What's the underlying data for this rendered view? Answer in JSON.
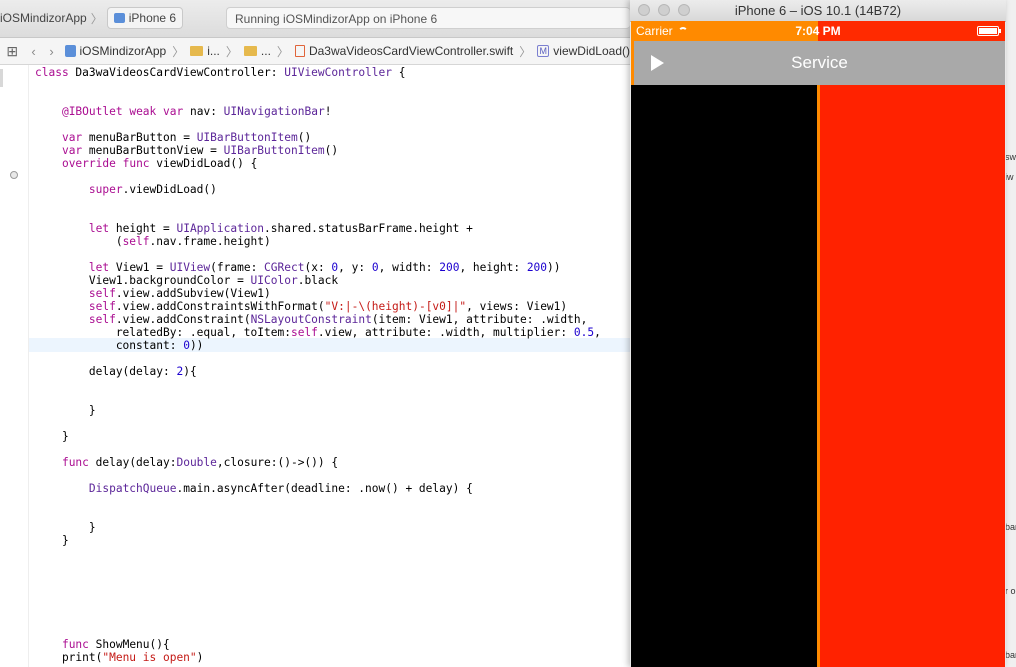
{
  "toolbar": {
    "scheme_name": "iOSMindizorApp",
    "device_name": "iPhone 6",
    "activity_status": "Running iOSMindizorApp on iPhone 6"
  },
  "jumpbar": {
    "crumbs": [
      "iOSMindizorApp",
      "i...",
      "...",
      "Da3waVideosCardViewController.swift",
      "viewDidLoad()"
    ]
  },
  "code": {
    "lines": [
      {
        "text": "class Da3waVideosCardViewController: UIViewController {"
      },
      {
        "text": "    @IBOutlet weak var nav: UINavigationBar!"
      },
      {
        "text": "    var menuBarButton = UIBarButtonItem()"
      },
      {
        "text": "    var menuBarButtonView = UIBarButtonItem()"
      },
      {
        "text": "    override func viewDidLoad() {"
      },
      {
        "text": "        super.viewDidLoad()"
      },
      {
        "text": "        let height = UIApplication.shared.statusBarFrame.height +"
      },
      {
        "text": "            (self.nav.frame.height)"
      },
      {
        "text": "        let View1 = UIView(frame: CGRect(x: 0, y: 0, width: 200, height: 200))"
      },
      {
        "text": "        View1.backgroundColor = UIColor.black"
      },
      {
        "text": "        self.view.addSubview(View1)"
      },
      {
        "text": "        self.view.addConstraintsWithFormat(\"V:|-\\(height)-[v0]|\", views: View1)"
      },
      {
        "text": "        self.view.addConstraint(NSLayoutConstraint(item: View1, attribute: .width,"
      },
      {
        "text": "            relatedBy: .equal, toItem:self.view, attribute: .width, multiplier: 0.5,"
      },
      {
        "text": "            constant: 0))"
      },
      {
        "text": "        delay(delay: 2){"
      },
      {
        "text": "        }"
      },
      {
        "text": "    }"
      },
      {
        "text": "    func delay(delay:Double,closure:()->()) {"
      },
      {
        "text": "        DispatchQueue.main.asyncAfter(deadline: .now() + delay) {"
      },
      {
        "text": "        }"
      },
      {
        "text": "    }"
      },
      {
        "text": "    func ShowMenu(){"
      },
      {
        "text": "    print(\"Menu is open\")"
      }
    ]
  },
  "background_strip": {
    "fragments": [
      "sw",
      "iw",
      "bar",
      "r o",
      "bar"
    ]
  },
  "simulator": {
    "window_title": "iPhone 6 – iOS 10.1 (14B72)",
    "status_bar": {
      "carrier": "Carrier",
      "time": "7:04 PM"
    },
    "nav_title": "Service",
    "colors": {
      "status_orange": "#ff8a00",
      "red_view": "#ff2200",
      "black_view": "#000000",
      "navbar": "#a9a9a9"
    }
  }
}
